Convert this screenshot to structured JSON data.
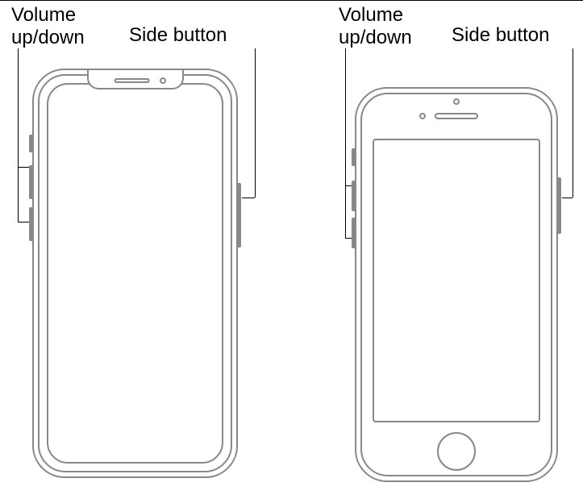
{
  "left": {
    "volume_label": "Volume\nup/down",
    "side_label": "Side button"
  },
  "right": {
    "volume_label": "Volume\nup/down",
    "side_label": "Side button"
  }
}
